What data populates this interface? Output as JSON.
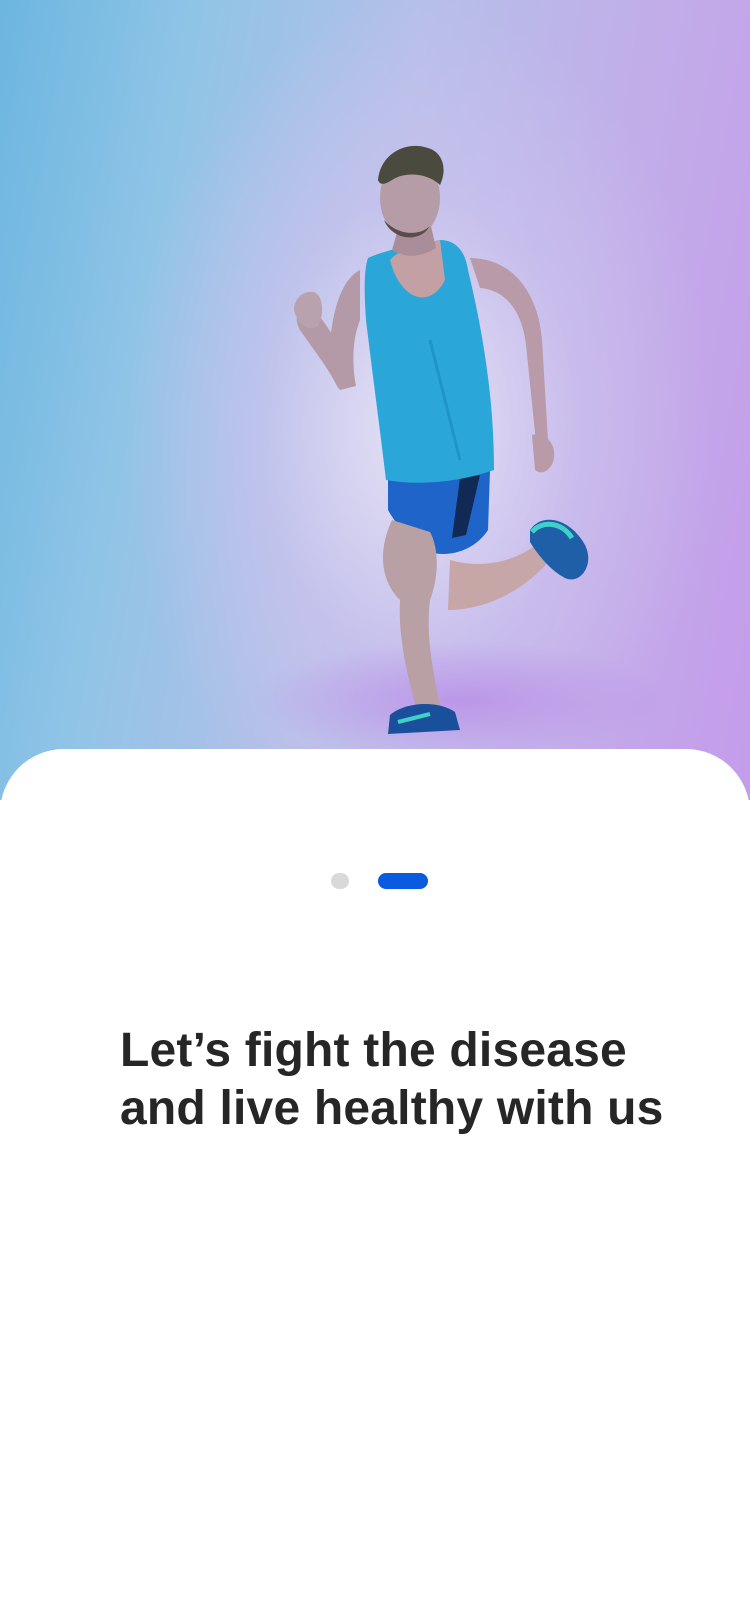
{
  "onboarding": {
    "hero_image": "runner-photo",
    "pager": {
      "total": 2,
      "active_index": 2,
      "inactive_color": "#d9d9d9",
      "active_color": "#0a5be0"
    },
    "headline_line1": "Let’s fight the disease",
    "headline_line2": "and live healthy with us"
  },
  "colors": {
    "gradient_left": "#6cb6e0",
    "gradient_right": "#c49cea",
    "card_background": "#ffffff",
    "headline_text": "#262626"
  }
}
